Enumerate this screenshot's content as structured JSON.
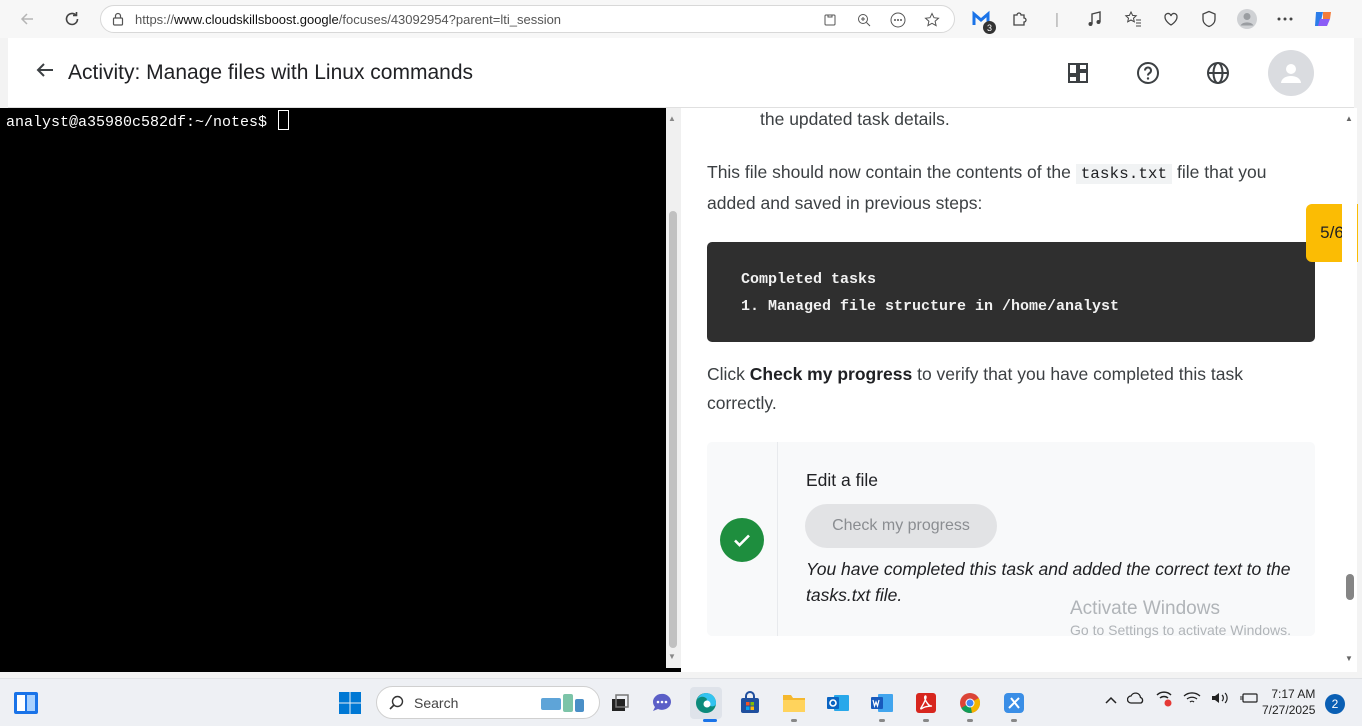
{
  "browser": {
    "url_prefix": "https://",
    "url_host": "www.cloudskillsboost.google",
    "url_path": "/focuses/43092954?parent=lti_session",
    "extension_badge": "3"
  },
  "header": {
    "title": "Activity: Manage files with Linux commands"
  },
  "terminal": {
    "prompt": "analyst@a35980c582df:~/notes$"
  },
  "content": {
    "top_fragment": "the updated task details.",
    "p1_before": "This file should now contain the contents of the ",
    "p1_code": "tasks.txt",
    "p1_after": " file that you added and saved in previous steps:",
    "code_lines": [
      "Completed tasks",
      "1. Managed file structure in /home/analyst"
    ],
    "p2_before": "Click ",
    "p2_bold": "Check my progress",
    "p2_after": " to verify that you have completed this task correctly.",
    "task": {
      "title": "Edit a file",
      "button_label": "Check my progress",
      "message": "You have completed this task and added the correct text to the tasks.txt file."
    },
    "step_badge": "5/6",
    "watermark_title": "Activate Windows",
    "watermark_sub": "Go to Settings to activate Windows."
  },
  "taskbar": {
    "search_placeholder": "Search",
    "time": "7:17 AM",
    "date": "7/27/2025",
    "notification_count": "2"
  },
  "colors": {
    "accent_badge": "#fbbc04",
    "success": "#1e8e3e",
    "terminal_bg": "#000000",
    "code_bg": "#2f2f2f"
  }
}
